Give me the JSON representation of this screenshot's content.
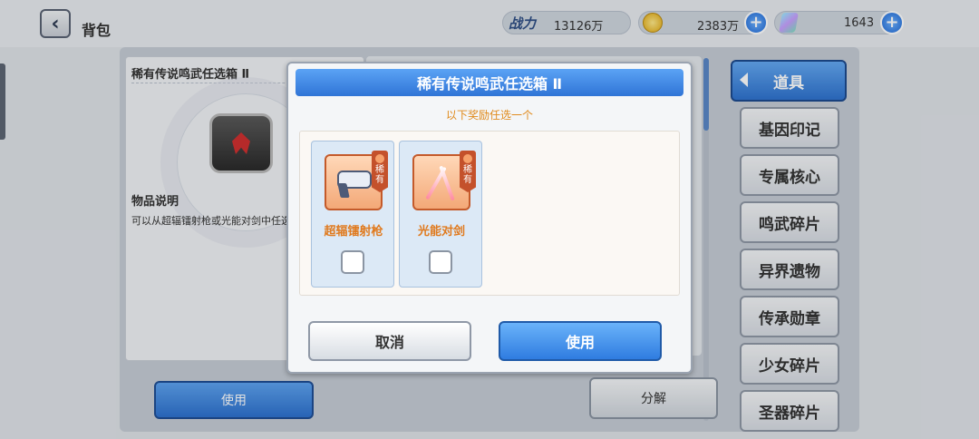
{
  "header": {
    "title": "背包",
    "power_label": "战力",
    "power_value": "13126万",
    "coins_value": "2383万",
    "gems_value": "1643"
  },
  "detail": {
    "item_title": "稀有传说鸣武任选箱 Ⅱ",
    "description_heading": "物品说明",
    "description_text": "可以从超辐镭射枪或光能对剑中任选"
  },
  "actions": {
    "use_label": "使用",
    "decompose_label": "分解"
  },
  "categories": [
    {
      "label": "道具",
      "active": true
    },
    {
      "label": "基因印记"
    },
    {
      "label": "专属核心"
    },
    {
      "label": "鸣武碎片"
    },
    {
      "label": "异界遗物"
    },
    {
      "label": "传承勋章"
    },
    {
      "label": "少女碎片"
    },
    {
      "label": "圣器碎片"
    }
  ],
  "dialog": {
    "title": "稀有传说鸣武任选箱 Ⅱ",
    "subtitle": "以下奖励任选一个",
    "choices": [
      {
        "name": "超辐镭射枪",
        "rarity": "稀有",
        "icon": "laser-gun-icon",
        "checked": false
      },
      {
        "name": "光能对剑",
        "rarity": "稀有",
        "icon": "light-swords-icon",
        "checked": false
      }
    ],
    "cancel_label": "取消",
    "confirm_label": "使用"
  },
  "colors": {
    "accent_blue": "#2f74d6",
    "rarity_orange": "#c4512b",
    "subtitle_orange": "#e08a1c"
  }
}
